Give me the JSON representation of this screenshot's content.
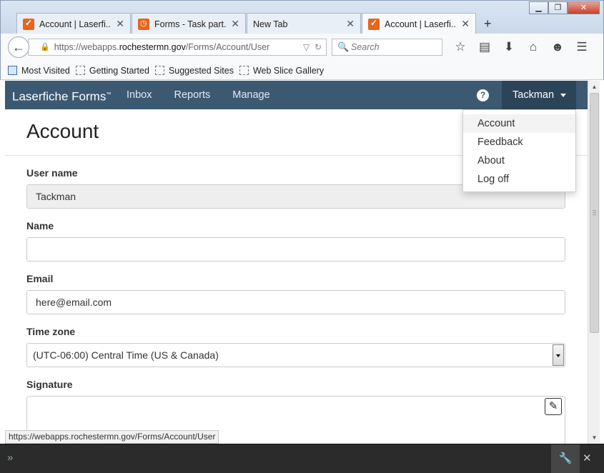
{
  "browser": {
    "tabs": [
      {
        "label": "Account | Laserfi...",
        "favicon": "laserfiche-favicon",
        "active": false
      },
      {
        "label": "Forms - Task part...",
        "favicon": "task-favicon",
        "active": false
      },
      {
        "label": "New Tab",
        "favicon": "",
        "active": false
      },
      {
        "label": "Account | Laserfi...",
        "favicon": "laserfiche-favicon",
        "active": true
      }
    ],
    "new_tab_label": "+",
    "url_prefix": "https://webapps.",
    "url_host": "rochestermn.gov",
    "url_path": "/Forms/Account/User",
    "search_placeholder": "Search",
    "bookmarks": [
      "Most Visited",
      "Getting Started",
      "Suggested Sites",
      "Web Slice Gallery"
    ],
    "status_url": "https://webapps.rochestermn.gov/Forms/Account/User"
  },
  "app": {
    "brand": "Laserfiche Forms",
    "brand_tm": "™",
    "nav": [
      "Inbox",
      "Reports",
      "Manage"
    ],
    "help_icon": "?",
    "user": "Tackman",
    "menu": [
      "Account",
      "Feedback",
      "About",
      "Log off"
    ],
    "menu_highlighted": "Account",
    "colors": {
      "navbar": "#3c5972",
      "user_button": "#2c4457"
    }
  },
  "page": {
    "title": "Account",
    "username_label": "User name",
    "username_value": "Tackman",
    "name_label": "Name",
    "name_value": "",
    "email_label": "Email",
    "email_value": "here@email.com",
    "timezone_label": "Time zone",
    "timezone_value": "(UTC-06:00) Central Time (US & Canada)",
    "signature_label": "Signature"
  }
}
